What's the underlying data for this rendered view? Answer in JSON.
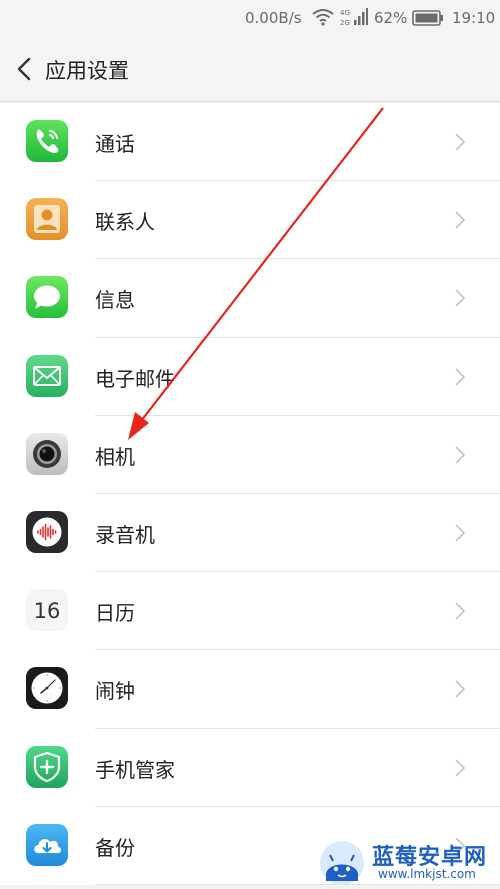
{
  "status_bar": {
    "net_rate": "0.00B/s",
    "network_type_top": "4G",
    "network_type_bottom": "2G",
    "battery_percent": "62%",
    "time": "19:10"
  },
  "header": {
    "title": "应用设置"
  },
  "items": [
    {
      "label": "通话",
      "icon": "phone-icon"
    },
    {
      "label": "联系人",
      "icon": "contacts-icon"
    },
    {
      "label": "信息",
      "icon": "messages-icon"
    },
    {
      "label": "电子邮件",
      "icon": "email-icon"
    },
    {
      "label": "相机",
      "icon": "camera-icon"
    },
    {
      "label": "录音机",
      "icon": "recorder-icon"
    },
    {
      "label": "日历",
      "icon": "calendar-icon",
      "icon_text": "16"
    },
    {
      "label": "闹钟",
      "icon": "clock-icon"
    },
    {
      "label": "手机管家",
      "icon": "phone-manager-icon"
    },
    {
      "label": "备份",
      "icon": "backup-icon"
    }
  ],
  "watermark": {
    "title": "蓝莓安卓网",
    "url": "www.lmkjst.com"
  },
  "colors": {
    "arrow": "#e8241c",
    "watermark": "#1f5fc4"
  }
}
